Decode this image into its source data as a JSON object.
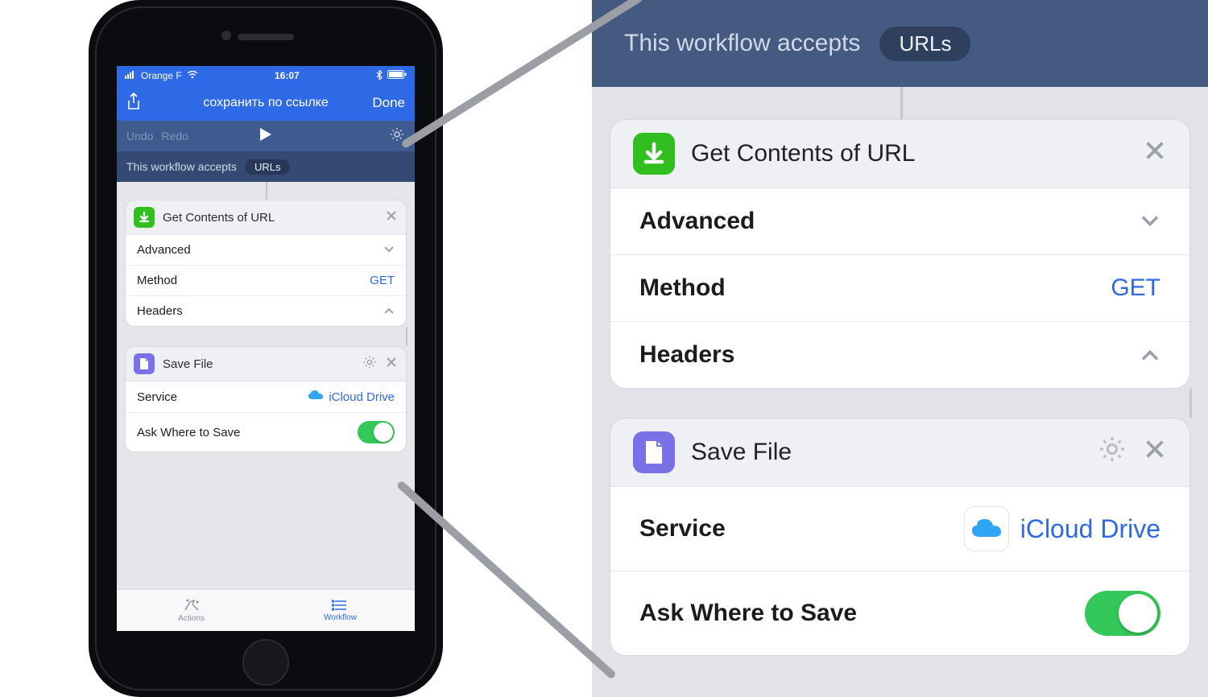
{
  "status": {
    "carrier": "Orange F",
    "time": "16:07"
  },
  "nav": {
    "title": "сохранить по ссылке",
    "done": "Done"
  },
  "toolbar": {
    "undo": "Undo",
    "redo": "Redo"
  },
  "accepts": {
    "label": "This workflow accepts",
    "value": "URLs"
  },
  "actions": [
    {
      "title": "Get Contents of URL",
      "icon": "download-arrow",
      "icon_color": "green",
      "rows": [
        {
          "label": "Advanced",
          "type": "chevron-down"
        },
        {
          "label": "Method",
          "value": "GET",
          "type": "value"
        },
        {
          "label": "Headers",
          "type": "chevron-up"
        }
      ],
      "has_gear": false
    },
    {
      "title": "Save File",
      "icon": "file",
      "icon_color": "purple",
      "rows": [
        {
          "label": "Service",
          "value": "iCloud Drive",
          "type": "service"
        },
        {
          "label": "Ask Where to Save",
          "type": "switch",
          "on": true
        }
      ],
      "has_gear": true
    }
  ],
  "tabs": {
    "actions": "Actions",
    "workflow": "Workflow"
  }
}
